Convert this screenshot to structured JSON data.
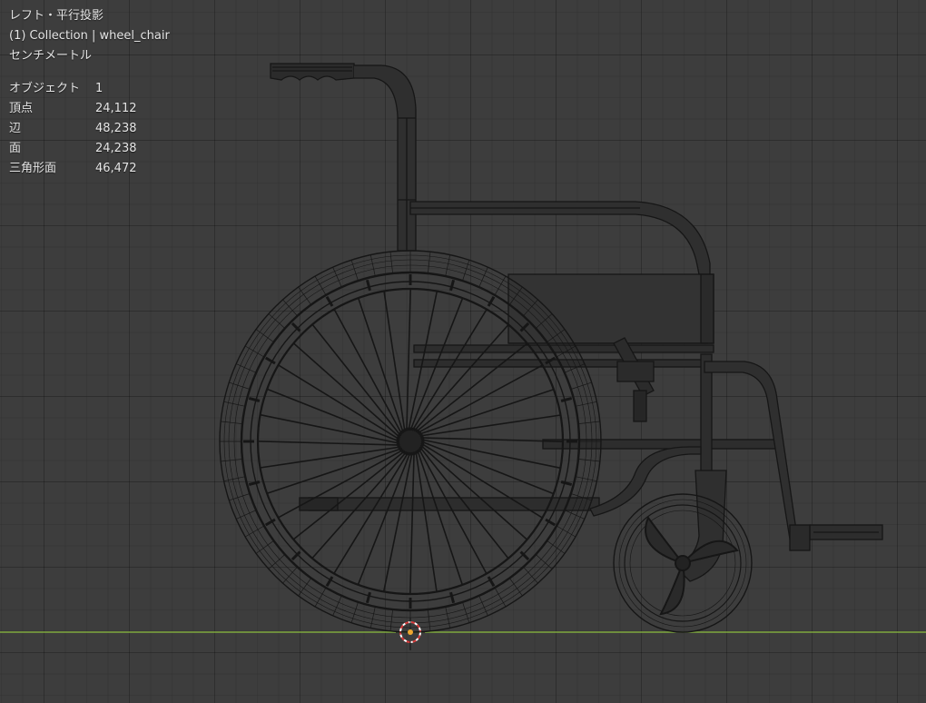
{
  "viewport": {
    "view_name": "レフト・平行投影",
    "collection_line": "(1) Collection | wheel_chair",
    "units": "センチメートル",
    "colors": {
      "background": "#3d3d3d",
      "ground_line": "#8dbf3f",
      "wire": "#161616",
      "cursor_red": "#d63a3a",
      "origin_dot": "#f0a830"
    }
  },
  "stats": [
    {
      "label": "オブジェクト",
      "value": "1"
    },
    {
      "label": "頂点",
      "value": "24,112"
    },
    {
      "label": "辺",
      "value": "48,238"
    },
    {
      "label": "面",
      "value": "24,238"
    },
    {
      "label": "三角形面",
      "value": "46,472"
    }
  ],
  "icons": {
    "cursor": "3d-cursor-icon"
  }
}
